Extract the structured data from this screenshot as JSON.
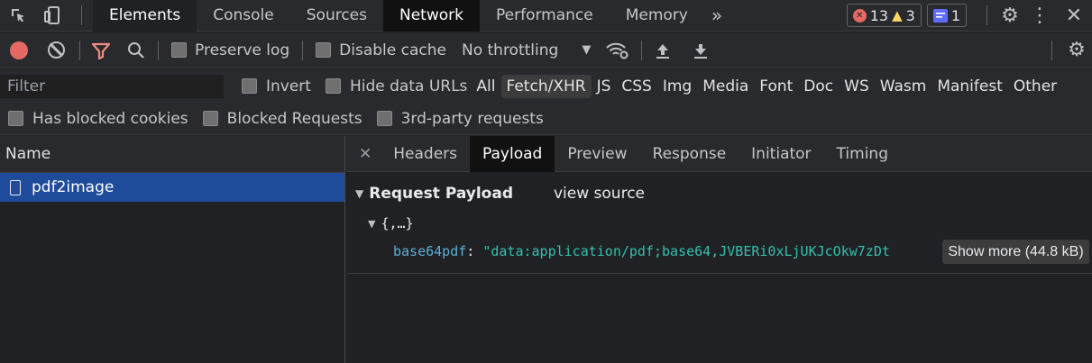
{
  "main_tabs": [
    {
      "label": "Elements"
    },
    {
      "label": "Console"
    },
    {
      "label": "Sources"
    },
    {
      "label": "Network"
    },
    {
      "label": "Performance"
    },
    {
      "label": "Memory"
    }
  ],
  "more_tabs_glyph": "»",
  "counters": {
    "errors": "13",
    "warnings": "3",
    "messages": "1"
  },
  "network_toolbar": {
    "preserve_log": "Preserve log",
    "disable_cache": "Disable cache",
    "throttling": "No throttling"
  },
  "filter": {
    "placeholder": "Filter",
    "invert": "Invert",
    "hide_data_urls": "Hide data URLs",
    "types": [
      "All",
      "Fetch/XHR",
      "JS",
      "CSS",
      "Img",
      "Media",
      "Font",
      "Doc",
      "WS",
      "Wasm",
      "Manifest",
      "Other"
    ],
    "selected_type": "Fetch/XHR"
  },
  "blocked": {
    "has_blocked_cookies": "Has blocked cookies",
    "blocked_requests": "Blocked Requests",
    "third_party": "3rd-party requests"
  },
  "requests": {
    "column_name": "Name",
    "items": [
      {
        "name": "pdf2image"
      }
    ]
  },
  "detail_tabs": [
    "Headers",
    "Payload",
    "Preview",
    "Response",
    "Initiator",
    "Timing"
  ],
  "payload": {
    "section_title": "Request Payload",
    "view_source": "view source",
    "object_preview": "{,…}",
    "key": "base64pdf",
    "value": "\"data:application/pdf;base64,JVBERi0xLjUKJcOkw7zDt",
    "show_more": "Show more (44.8 kB)"
  },
  "colors": {
    "accent_selected_row": "#1e4b9a",
    "record_red": "#e46962",
    "filter_red": "#f28b82",
    "message_badge": "#5e6cff",
    "json_key": "#5db0d7",
    "json_string": "#32c1ac"
  }
}
